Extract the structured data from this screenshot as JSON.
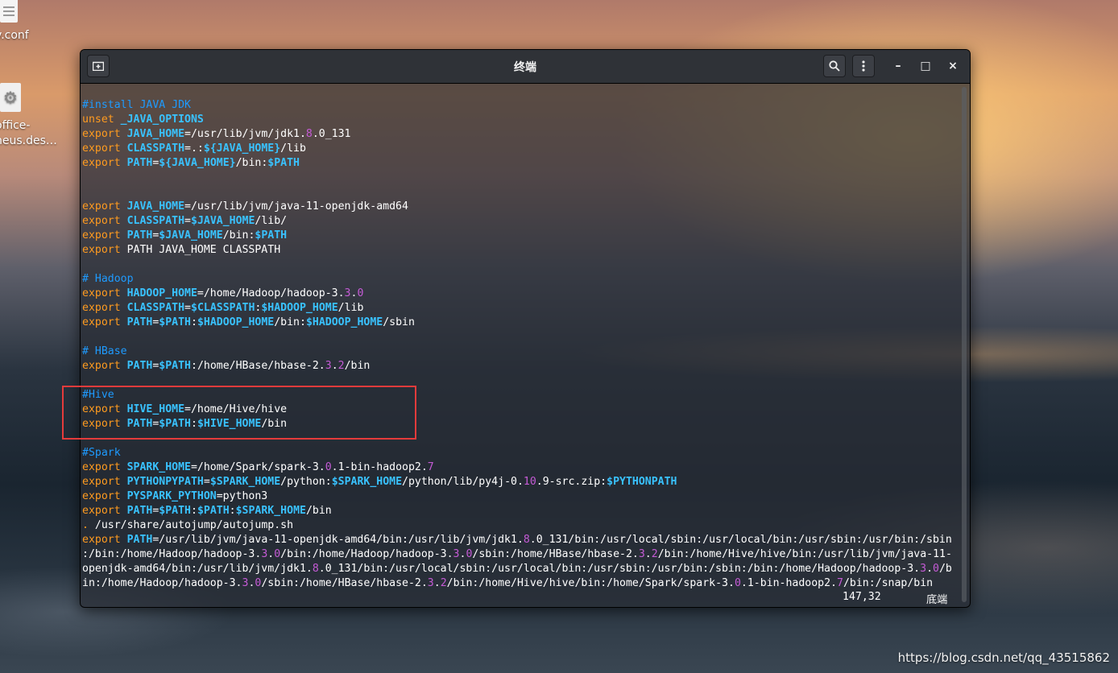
{
  "desktop": {
    "icons": [
      {
        "label": "v.conf",
        "icon": "text-file-icon"
      },
      {
        "label": "office-\nneus.des…",
        "icon": "gear-file-icon"
      }
    ],
    "watermark": "https://blog.csdn.net/qq_43515862"
  },
  "window": {
    "title": "终端",
    "new_tab_icon": "new-tab-icon",
    "search_icon": "search-icon",
    "menu_icon": "kebab-menu-icon",
    "minimize": "–",
    "maximize": "□",
    "close": "×"
  },
  "terminal": {
    "lines": [
      [
        [
          "c",
          "#install JAVA JDK"
        ]
      ],
      [
        [
          "k",
          "unset "
        ],
        [
          "v",
          "_JAVA_OPTIONS"
        ]
      ],
      [
        [
          "k",
          "export "
        ],
        [
          "v",
          "JAVA_HOME"
        ],
        [
          "t",
          "=/usr/lib/jvm/jdk1."
        ],
        [
          "d",
          "8"
        ],
        [
          "t",
          ".0_131"
        ]
      ],
      [
        [
          "k",
          "export "
        ],
        [
          "v",
          "CLASSPATH"
        ],
        [
          "t",
          "=.:"
        ],
        [
          "v",
          "${JAVA_HOME}"
        ],
        [
          "t",
          "/lib"
        ]
      ],
      [
        [
          "k",
          "export "
        ],
        [
          "v",
          "PATH"
        ],
        [
          "t",
          "="
        ],
        [
          "v",
          "${JAVA_HOME}"
        ],
        [
          "t",
          "/bin:"
        ],
        [
          "v",
          "$PATH"
        ]
      ],
      [],
      [],
      [
        [
          "k",
          "export "
        ],
        [
          "v",
          "JAVA_HOME"
        ],
        [
          "t",
          "=/usr/lib/jvm/java-11-openjdk-amd64"
        ]
      ],
      [
        [
          "k",
          "export "
        ],
        [
          "v",
          "CLASSPATH"
        ],
        [
          "t",
          "="
        ],
        [
          "v",
          "$JAVA_HOME"
        ],
        [
          "t",
          "/lib/"
        ]
      ],
      [
        [
          "k",
          "export "
        ],
        [
          "v",
          "PATH"
        ],
        [
          "t",
          "="
        ],
        [
          "v",
          "$JAVA_HOME"
        ],
        [
          "t",
          "/bin:"
        ],
        [
          "v",
          "$PATH"
        ]
      ],
      [
        [
          "k",
          "export "
        ],
        [
          "t",
          "PATH JAVA_HOME CLASSPATH"
        ]
      ],
      [],
      [
        [
          "c",
          "# Hadoop"
        ]
      ],
      [
        [
          "k",
          "export "
        ],
        [
          "v",
          "HADOOP_HOME"
        ],
        [
          "t",
          "=/home/Hadoop/hadoop-3."
        ],
        [
          "d",
          "3"
        ],
        [
          "t",
          "."
        ],
        [
          "d",
          "0"
        ]
      ],
      [
        [
          "k",
          "export "
        ],
        [
          "v",
          "CLASSPATH"
        ],
        [
          "t",
          "="
        ],
        [
          "v",
          "$CLASSPATH"
        ],
        [
          "t",
          ":"
        ],
        [
          "v",
          "$HADOOP_HOME"
        ],
        [
          "t",
          "/lib"
        ]
      ],
      [
        [
          "k",
          "export "
        ],
        [
          "v",
          "PATH"
        ],
        [
          "t",
          "="
        ],
        [
          "v",
          "$PATH"
        ],
        [
          "t",
          ":"
        ],
        [
          "v",
          "$HADOOP_HOME"
        ],
        [
          "t",
          "/bin:"
        ],
        [
          "v",
          "$HADOOP_HOME"
        ],
        [
          "t",
          "/sbin"
        ]
      ],
      [],
      [
        [
          "c",
          "# HBase"
        ]
      ],
      [
        [
          "k",
          "export "
        ],
        [
          "v",
          "PATH"
        ],
        [
          "t",
          "="
        ],
        [
          "v",
          "$PATH"
        ],
        [
          "t",
          ":/home/HBase/hbase-2."
        ],
        [
          "d",
          "3"
        ],
        [
          "t",
          "."
        ],
        [
          "d",
          "2"
        ],
        [
          "t",
          "/bin"
        ]
      ],
      [],
      [
        [
          "c",
          "#Hive"
        ]
      ],
      [
        [
          "k",
          "export "
        ],
        [
          "v",
          "HIVE_HOME"
        ],
        [
          "t",
          "=/home/Hive/hive"
        ]
      ],
      [
        [
          "k",
          "export "
        ],
        [
          "v",
          "PATH"
        ],
        [
          "t",
          "="
        ],
        [
          "v",
          "$PATH"
        ],
        [
          "t",
          ":"
        ],
        [
          "v",
          "$HIVE_HOME"
        ],
        [
          "t",
          "/bin"
        ]
      ],
      [],
      [
        [
          "c",
          "#Spark"
        ]
      ],
      [
        [
          "k",
          "export "
        ],
        [
          "v",
          "SPARK_HOME"
        ],
        [
          "t",
          "=/home/Spark/spark-3."
        ],
        [
          "d",
          "0"
        ],
        [
          "t",
          ".1-bin-hadoop2."
        ],
        [
          "d",
          "7"
        ]
      ],
      [
        [
          "k",
          "export "
        ],
        [
          "v",
          "PYTHONPYPATH"
        ],
        [
          "t",
          "="
        ],
        [
          "v",
          "$SPARK_HOME"
        ],
        [
          "t",
          "/python:"
        ],
        [
          "v",
          "$SPARK_HOME"
        ],
        [
          "t",
          "/python/lib/py4j-0."
        ],
        [
          "d",
          "10"
        ],
        [
          "t",
          ".9-src.zip:"
        ],
        [
          "v",
          "$PYTHONPATH"
        ]
      ],
      [
        [
          "k",
          "export "
        ],
        [
          "v",
          "PYSPARK_PYTHON"
        ],
        [
          "t",
          "=python3"
        ]
      ],
      [
        [
          "k",
          "export "
        ],
        [
          "v",
          "PATH"
        ],
        [
          "t",
          "="
        ],
        [
          "v",
          "$PATH"
        ],
        [
          "t",
          ":"
        ],
        [
          "v",
          "$PATH"
        ],
        [
          "t",
          ":"
        ],
        [
          "v",
          "$SPARK_HOME"
        ],
        [
          "t",
          "/bin"
        ]
      ],
      [
        [
          "k",
          ". "
        ],
        [
          "t",
          "/usr/share/autojump/autojump.sh"
        ]
      ],
      [
        [
          "k",
          "export "
        ],
        [
          "v",
          "PATH"
        ],
        [
          "t",
          "=/usr/lib/jvm/java-11-openjdk-amd64/bin:/usr/lib/jvm/jdk1."
        ],
        [
          "d",
          "8"
        ],
        [
          "t",
          ".0_131/bin:/usr/local/sbin:/usr/local/bin:/usr/sbin:/usr/bin:/sbin"
        ]
      ],
      [
        [
          "t",
          ":/bin:/home/Hadoop/hadoop-3."
        ],
        [
          "d",
          "3"
        ],
        [
          "t",
          "."
        ],
        [
          "d",
          "0"
        ],
        [
          "t",
          "/bin:/home/Hadoop/hadoop-3."
        ],
        [
          "d",
          "3"
        ],
        [
          "t",
          "."
        ],
        [
          "d",
          "0"
        ],
        [
          "t",
          "/sbin:/home/HBase/hbase-2."
        ],
        [
          "d",
          "3"
        ],
        [
          "t",
          "."
        ],
        [
          "d",
          "2"
        ],
        [
          "t",
          "/bin:/home/Hive/hive/bin:/usr/lib/jvm/java-11-"
        ]
      ],
      [
        [
          "t",
          "openjdk-amd64/bin:/usr/lib/jvm/jdk1."
        ],
        [
          "d",
          "8"
        ],
        [
          "t",
          ".0_131/bin:/usr/local/sbin:/usr/local/bin:/usr/sbin:/usr/bin:/sbin:/bin:/home/Hadoop/hadoop-3."
        ],
        [
          "d",
          "3"
        ],
        [
          "t",
          "."
        ],
        [
          "d",
          "0"
        ],
        [
          "t",
          "/b"
        ]
      ],
      [
        [
          "t",
          "in:/home/Hadoop/hadoop-3."
        ],
        [
          "d",
          "3"
        ],
        [
          "t",
          "."
        ],
        [
          "d",
          "0"
        ],
        [
          "t",
          "/sbin:/home/HBase/hbase-2."
        ],
        [
          "d",
          "3"
        ],
        [
          "t",
          "."
        ],
        [
          "d",
          "2"
        ],
        [
          "t",
          "/bin:/home/Hive/hive/bin:/home/Spark/spark-3."
        ],
        [
          "d",
          "0"
        ],
        [
          "t",
          ".1-bin-hadoop2."
        ],
        [
          "d",
          "7"
        ],
        [
          "t",
          "/bin:/snap/bin"
        ]
      ]
    ],
    "status_position": "147,32",
    "status_tail": "底端"
  }
}
